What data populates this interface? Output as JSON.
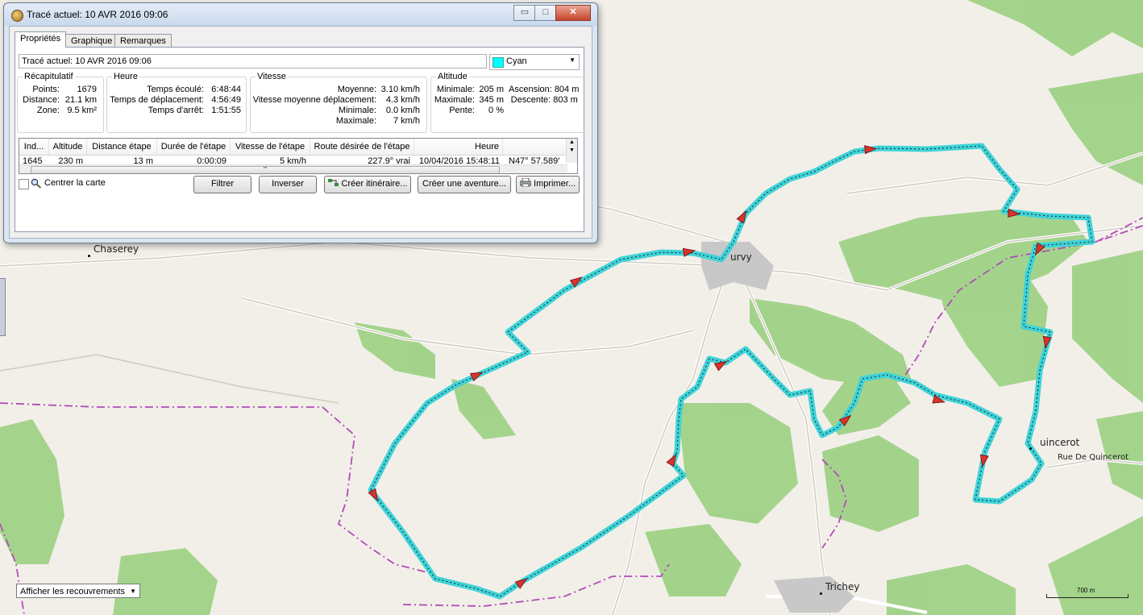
{
  "window": {
    "title": "Tracé actuel: 10 AVR 2016 09:06",
    "controls": {
      "minimize": "▭",
      "maximize": "□",
      "close": "✕"
    }
  },
  "tabs": [
    {
      "label": "Propriétés",
      "active": true
    },
    {
      "label": "Graphique",
      "active": false
    },
    {
      "label": "Remarques",
      "active": false
    }
  ],
  "track_name": "Tracé actuel: 10 AVR 2016 09:06",
  "color": {
    "label": "Cyan",
    "hex": "#00ffff"
  },
  "summary": {
    "title": "Récapitulatif",
    "rows": [
      {
        "k": "Points:",
        "v": "1679"
      },
      {
        "k": "Distance:",
        "v": "21.1 km"
      },
      {
        "k": "Zone:",
        "v": "9.5 km²"
      }
    ]
  },
  "time": {
    "title": "Heure",
    "rows": [
      {
        "k": "Temps écoulé:",
        "v": "6:48:44"
      },
      {
        "k": "Temps de déplacement:",
        "v": "4:56:49"
      },
      {
        "k": "Temps d'arrêt:",
        "v": "1:51:55"
      }
    ]
  },
  "speed": {
    "title": "Vitesse",
    "rows": [
      {
        "k": "Moyenne:",
        "v": "3.10 km/h"
      },
      {
        "k": "Vitesse moyenne déplacement:",
        "v": "4.3 km/h"
      },
      {
        "k": "Minimale:",
        "v": "0.0 km/h"
      },
      {
        "k": "Maximale:",
        "v": "7 km/h"
      }
    ]
  },
  "altitude": {
    "title": "Altitude",
    "rows_left": [
      {
        "k": "Minimale:",
        "v": "205 m"
      },
      {
        "k": "Maximale:",
        "v": "345 m"
      },
      {
        "k": "Pente:",
        "v": "0 %"
      }
    ],
    "rows_right": [
      {
        "k": "Ascension:",
        "v": "804 m"
      },
      {
        "k": "Descente:",
        "v": "803 m"
      }
    ]
  },
  "table": {
    "columns": [
      "Ind...",
      "Altitude",
      "Distance étape",
      "Durée de l'étape",
      "Vitesse de l'étape",
      "Route désirée de l'étape",
      "Heure",
      ""
    ],
    "row": [
      "1645",
      "230 m",
      "13 m",
      "0:00:09",
      "5 km/h",
      "227.9° vrai",
      "10/04/2016 15:48:11",
      "N47° 57.589'"
    ],
    "scroll_thumb": "'''"
  },
  "center_map_label": "Centrer la carte",
  "buttons": {
    "filter": "Filtrer",
    "reverse": "Inverser",
    "create_route": "Créer itinéraire...",
    "create_adventure": "Créer une aventure...",
    "print": "Imprimer..."
  },
  "map": {
    "places": {
      "chaserey": "Chaserey",
      "curvy": "urvy",
      "quincerot": "uincerot",
      "rue_quincerot": "Rue De Quincerot",
      "trichey": "Trichey"
    },
    "overlay_select": "Afficher les recouvrements",
    "scale": "700 m",
    "track_color": "#3fd3d8",
    "forest_color": "#9bd081",
    "boundary_color": "#b04cb6"
  }
}
